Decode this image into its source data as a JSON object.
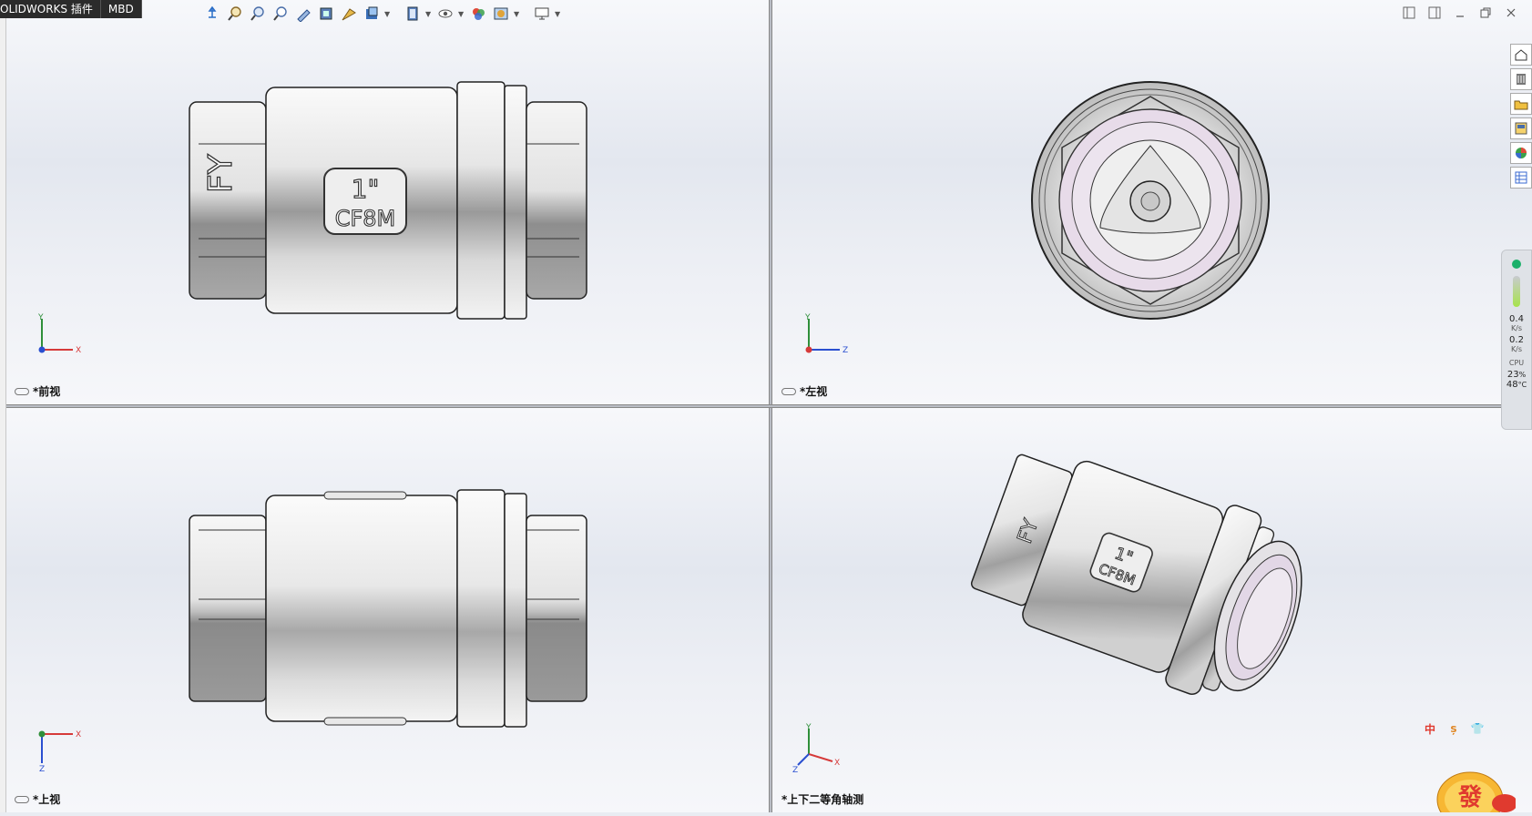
{
  "tabs": [
    {
      "label": "OLIDWORKS 插件"
    },
    {
      "label": "MBD"
    }
  ],
  "toolbar": {
    "icons": [
      "view-orient-icon",
      "zoom-to-fit-icon",
      "zoom-area-icon",
      "previous-view-icon",
      "section-view-icon",
      "dynamic-annotation-icon",
      "view-orientation-icon",
      "display-style-icon",
      "hide-show-items-icon",
      "edit-appearance-icon",
      "apply-scene-icon",
      "view-settings-icon"
    ]
  },
  "viewports": [
    {
      "label": "*前视",
      "triad_h": "X",
      "triad_v": "Y"
    },
    {
      "label": "*左视",
      "triad_h": "Z",
      "triad_v": "Y"
    },
    {
      "label": "*上视",
      "triad_h": "X",
      "triad_v": "Z"
    },
    {
      "label": "*上下二等角轴测",
      "triad_h": "X",
      "triad_v": "Y",
      "triad_d": "Z"
    }
  ],
  "part_marking": {
    "brand": "FY",
    "size": "1\"",
    "material": "CF8M"
  },
  "monitor": {
    "up_value": "0.4",
    "up_unit": "K/s",
    "down_value": "0.2",
    "down_unit": "K/s",
    "cpu_label": "CPU",
    "cpu_value": "23",
    "cpu_unit": "%",
    "temp_value": "48",
    "temp_unit": "°C"
  },
  "ime": {
    "lang": "中",
    "punct": "ș",
    "skin": "👕"
  },
  "mascot_text": "發",
  "colors": {
    "accent_red": "#e03a2f",
    "axis_x": "#d63a3a",
    "axis_y": "#2f8f3a",
    "axis_z": "#2a4fd0",
    "viewport_bg": "#e6e9f0"
  }
}
